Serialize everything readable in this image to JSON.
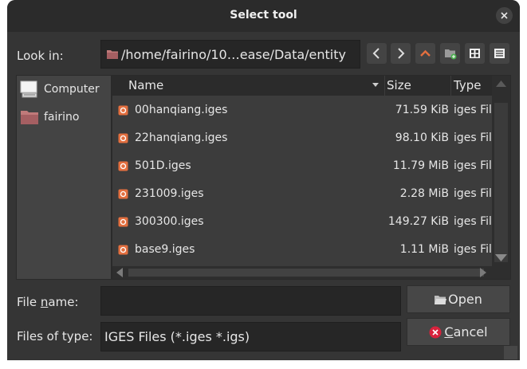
{
  "dialog": {
    "title": "Select tool",
    "look_in_label": "Look in:",
    "path": "/home/fairino/10…ease/Data/entity",
    "toolbar": {
      "back": "chevron-left-icon",
      "forward": "chevron-right-icon",
      "up": "chevron-up-icon",
      "new_folder": "new-folder-icon",
      "icon_view": "grid-view-icon",
      "detail_view": "detail-view-icon"
    },
    "accent_color": "#e36f3f"
  },
  "sidebar": {
    "items": [
      {
        "label": "Computer",
        "icon": "computer-icon"
      },
      {
        "label": "fairino",
        "icon": "folder-icon"
      }
    ]
  },
  "file_list": {
    "columns": [
      {
        "label": "Name"
      },
      {
        "label": "Size"
      },
      {
        "label": "Type"
      }
    ],
    "rows": [
      {
        "name": "00hanqiang.iges",
        "size": "71.59 KiB",
        "type": "iges File"
      },
      {
        "name": "22hanqiang.iges",
        "size": "98.10 KiB",
        "type": "iges File"
      },
      {
        "name": "501D.iges",
        "size": "11.79 MiB",
        "type": "iges File"
      },
      {
        "name": "231009.iges",
        "size": "2.28 MiB",
        "type": "iges File"
      },
      {
        "name": "300300.iges",
        "size": "149.27 KiB",
        "type": "iges File"
      },
      {
        "name": "base9.iges",
        "size": "1.11 MiB",
        "type": "iges File"
      }
    ]
  },
  "footer": {
    "file_name_label_pre": "File ",
    "file_name_label_ul": "n",
    "file_name_label_post": "ame:",
    "file_name_value": "",
    "files_of_type_label": "Files of type:",
    "files_of_type_value": "IGES Files (*.iges *.igs)",
    "open_label": "Open",
    "cancel_label_ul": "C",
    "cancel_label_post": "ancel"
  }
}
